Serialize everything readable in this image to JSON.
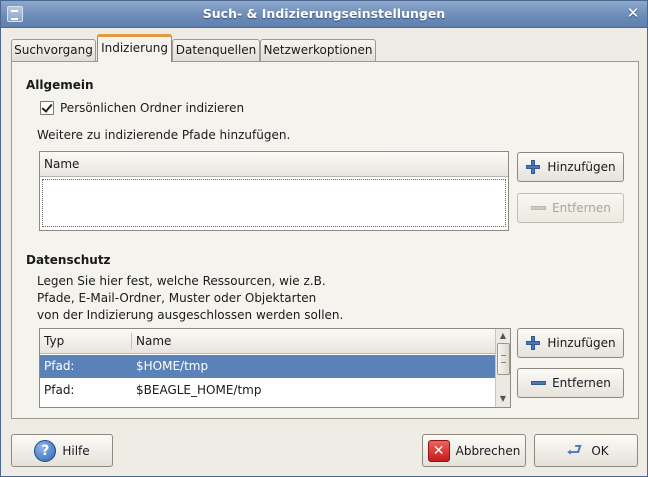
{
  "window": {
    "title": "Such- & Indizierungseinstellungen",
    "close_glyph": "✕"
  },
  "tabs": [
    {
      "label": "Suchvorgang"
    },
    {
      "label": "Indizierung"
    },
    {
      "label": "Datenquellen"
    },
    {
      "label": "Netzwerkoptionen"
    }
  ],
  "general": {
    "title": "Allgemein",
    "checkbox_label": "Persönlichen Ordner indizieren",
    "checkbox_checked": true,
    "paths_prompt": "Weitere zu indizierende Pfade hinzufügen.",
    "paths_list": {
      "column_name": "Name",
      "rows": []
    },
    "add_button": "Hinzufügen",
    "remove_button": "Entfernen"
  },
  "privacy": {
    "title": "Datenschutz",
    "description_lines": [
      "Legen Sie hier fest, welche Ressourcen, wie z.B.",
      "Pfade, E-Mail-Ordner, Muster oder Objektarten",
      "von der Indizierung ausgeschlossen werden sollen."
    ],
    "list": {
      "column_type": "Typ",
      "column_name": "Name",
      "rows": [
        {
          "type": "Pfad:",
          "name": "$HOME/tmp",
          "selected": true
        },
        {
          "type": "Pfad:",
          "name": "$BEAGLE_HOME/tmp",
          "selected": false
        }
      ]
    },
    "add_button": "Hinzufügen",
    "remove_button": "Entfernen"
  },
  "footer": {
    "help_button": "Hilfe",
    "cancel_button": "Abbrechen",
    "ok_button": "OK"
  },
  "icons": {
    "help": "help-icon",
    "cancel": "cancel-icon",
    "ok": "ok-icon",
    "add": "plus-icon",
    "remove": "minus-icon"
  },
  "colors": {
    "titlebar": "#6d8cb8",
    "selection": "#5a82b8",
    "active_tab_accent": "#e19a3d"
  }
}
